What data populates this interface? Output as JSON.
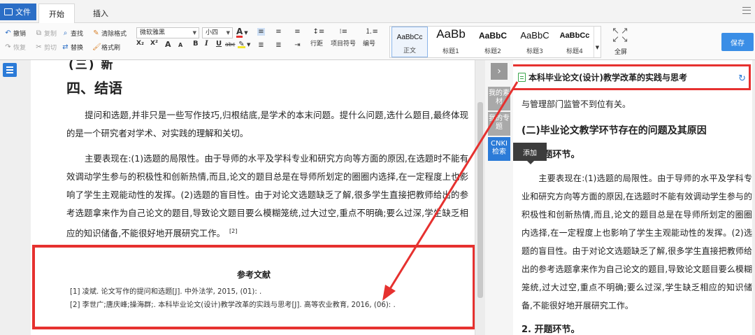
{
  "tabs": {
    "file": "文件",
    "start": "开始",
    "insert": "插入"
  },
  "ribbon": {
    "undo": "撤销",
    "redo": "恢复",
    "copy": "复制",
    "cut": "剪切",
    "find": "查找",
    "replace": "替换",
    "clear_format": "清除格式",
    "format_brush": "格式刷",
    "font_family": "微软雅黑",
    "font_size": "小四",
    "bold": "B",
    "italic": "I",
    "underline": "U",
    "strike": "abc",
    "sub": "X₂",
    "sup": "X²",
    "grow": "A",
    "shrink": "A",
    "line_spacing": "行距",
    "bullets": "项目符号",
    "numbering": "编号",
    "fullscreen": "全屏",
    "save": "保存"
  },
  "styles": [
    {
      "sample": "AaBbCc",
      "label": "正文"
    },
    {
      "sample": "AaBb",
      "label": "标题1"
    },
    {
      "sample": "AaBbC",
      "label": "标题2"
    },
    {
      "sample": "AaBbC",
      "label": "标题3"
    },
    {
      "sample": "AaBbCc",
      "label": "标题4"
    }
  ],
  "document": {
    "cut_heading": "(三) 新",
    "section_heading": "四、结语",
    "para1": "提问和选题,并非只是一些写作技巧,归根结底,是学术的本末问题。提什么问题,选什么题目,最终体现的是一个研究者对学术、对实践的理解和关切。",
    "para2": "主要表现在:(1)选题的局限性。由于导师的水平及学科专业和研究方向等方面的原因,在选题时不能有效调动学生参与的积极性和创新热情,而且,论文的题目总是在导师所划定的圈圈内选择,在一定程度上也影响了学生主观能动性的发挥。(2)选题的盲目性。由于对论文选题缺乏了解,很多学生直接把教师给出的参考选题拿来作为自己论文的题目,导致论文题目要么模糊笼统,过大过空,重点不明确;要么过深,学生缺乏相应的知识储备,不能很好地开展研究工作。",
    "para2_cite": "[2]",
    "refs_title": "参考文献",
    "ref1": "[1] 凌斌. 论文写作的提问和选题[J]. 中外法学, 2015, (01): .",
    "ref2": "[2] 李世广;唐庆峰;操海群;. 本科毕业论文(设计)教学改革的实践与思考[J]. 高等农业教育, 2016, (06): ."
  },
  "side_tabs": {
    "collapse": "›",
    "materials": "我的素材",
    "topics": "我的专题",
    "cnki": "CNKI检索"
  },
  "panel": {
    "title": "本科毕业论文(设计)教学改革的实践与思考",
    "line0": "与管理部门监管不到位有关。",
    "heading": "(二)毕业论文教学环节存在的问题及其原因",
    "subheading": "1. 选题环节。",
    "tooltip": "添加",
    "para": "主要表现在:(1)选题的局限性。由于导师的水平及学科专业和研究方向等方面的原因,在选题时不能有效调动学生参与的积极性和创新热情,而且,论文的题目总是在导师所划定的圈圈内选择,在一定程度上也影响了学生主观能动性的发挥。(2)选题的盲目性。由于对论文选题缺乏了解,很多学生直接把教师给出的参考选题拿来作为自己论文的题目,导致论文题目要么模糊笼统,过大过空,重点不明确;要么过深,学生缺乏相应的知识储备,不能很好地开展研究工作。",
    "heading2": "2. 开题环节。"
  },
  "colors": {
    "accent": "#2b6ec6",
    "highlight_red": "#e6312f",
    "save": "#3a8ee6"
  }
}
